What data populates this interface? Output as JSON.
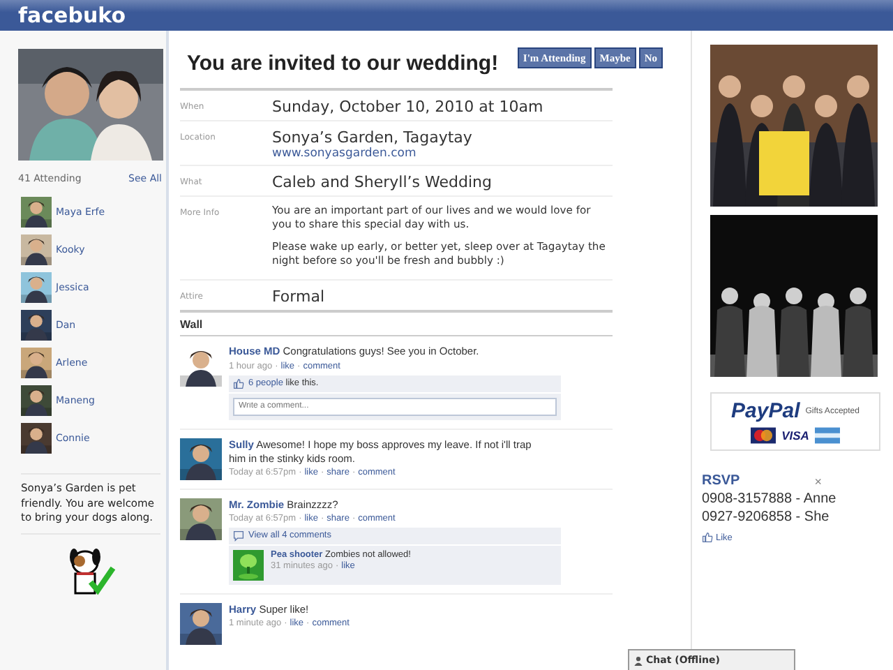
{
  "header": {
    "logo": "facebuko"
  },
  "sidebar": {
    "attending_count": "41 Attending",
    "see_all": "See All",
    "guests": [
      {
        "name": "Maya Erfe"
      },
      {
        "name": "Kooky"
      },
      {
        "name": "Jessica"
      },
      {
        "name": "Dan"
      },
      {
        "name": "Arlene"
      },
      {
        "name": "Maneng"
      },
      {
        "name": "Connie"
      }
    ],
    "note": "Sonya’s Garden is pet friendly. You are welcome to bring your dogs along."
  },
  "event": {
    "title": "You are invited to our wedding!",
    "buttons": [
      "I'm Attending",
      "Maybe",
      "No"
    ],
    "details": [
      {
        "label": "When",
        "value": "Sunday, October 10, 2010 at 10am"
      },
      {
        "label": "Location",
        "value": "Sonya’s Garden, Tagaytay",
        "link": "www.sonyasgarden.com"
      },
      {
        "label": "What",
        "value": "Caleb and Sheryll’s Wedding"
      },
      {
        "label": "More Info",
        "paragraphs": [
          "You are an important part of our lives and we would love for you to share this special day with us.",
          "Please wake up early, or better yet, sleep over at Tagaytay the night before so you'll be fresh and bubbly :)"
        ]
      },
      {
        "label": "Attire",
        "value": "Formal"
      }
    ]
  },
  "wall": {
    "title": "Wall",
    "separator": "·",
    "posts": [
      {
        "author": "House MD",
        "text": "Congratulations guys! See you in October.",
        "time": "1 hour ago",
        "actions": [
          "like",
          "comment"
        ],
        "likes": {
          "link": "6 people",
          "text": "like this."
        },
        "comment_placeholder": "Write a comment..."
      },
      {
        "author": "Sully",
        "text": "Awesome! I hope my boss approves my leave. If not i'll trap him in the stinky kids room.",
        "time": "Today at 6:57pm",
        "actions": [
          "like",
          "share",
          "comment"
        ]
      },
      {
        "author": "Mr. Zombie",
        "text": "Brainzzzz?",
        "time": "Today at 6:57pm",
        "actions": [
          "like",
          "share",
          "comment"
        ],
        "view_all": "View all 4 comments",
        "replies": [
          {
            "author": "Pea shooter",
            "text": "Zombies not allowed!",
            "time": "31 minutes ago",
            "actions": [
              "like"
            ]
          }
        ]
      },
      {
        "author": "Harry",
        "text": "Super like!",
        "time": "1 minute ago",
        "actions": [
          "like",
          "comment"
        ]
      }
    ]
  },
  "right": {
    "paypal": {
      "logo": "PayPal",
      "caption": "Gifts Accepted",
      "card": "VISA"
    },
    "rsvp": {
      "title": "RSVP",
      "close": "×",
      "lines": [
        "0908-3157888 - Anne",
        "0927-9206858 - She"
      ],
      "like": "Like"
    }
  },
  "chat": {
    "label": "Chat (Offline)"
  }
}
